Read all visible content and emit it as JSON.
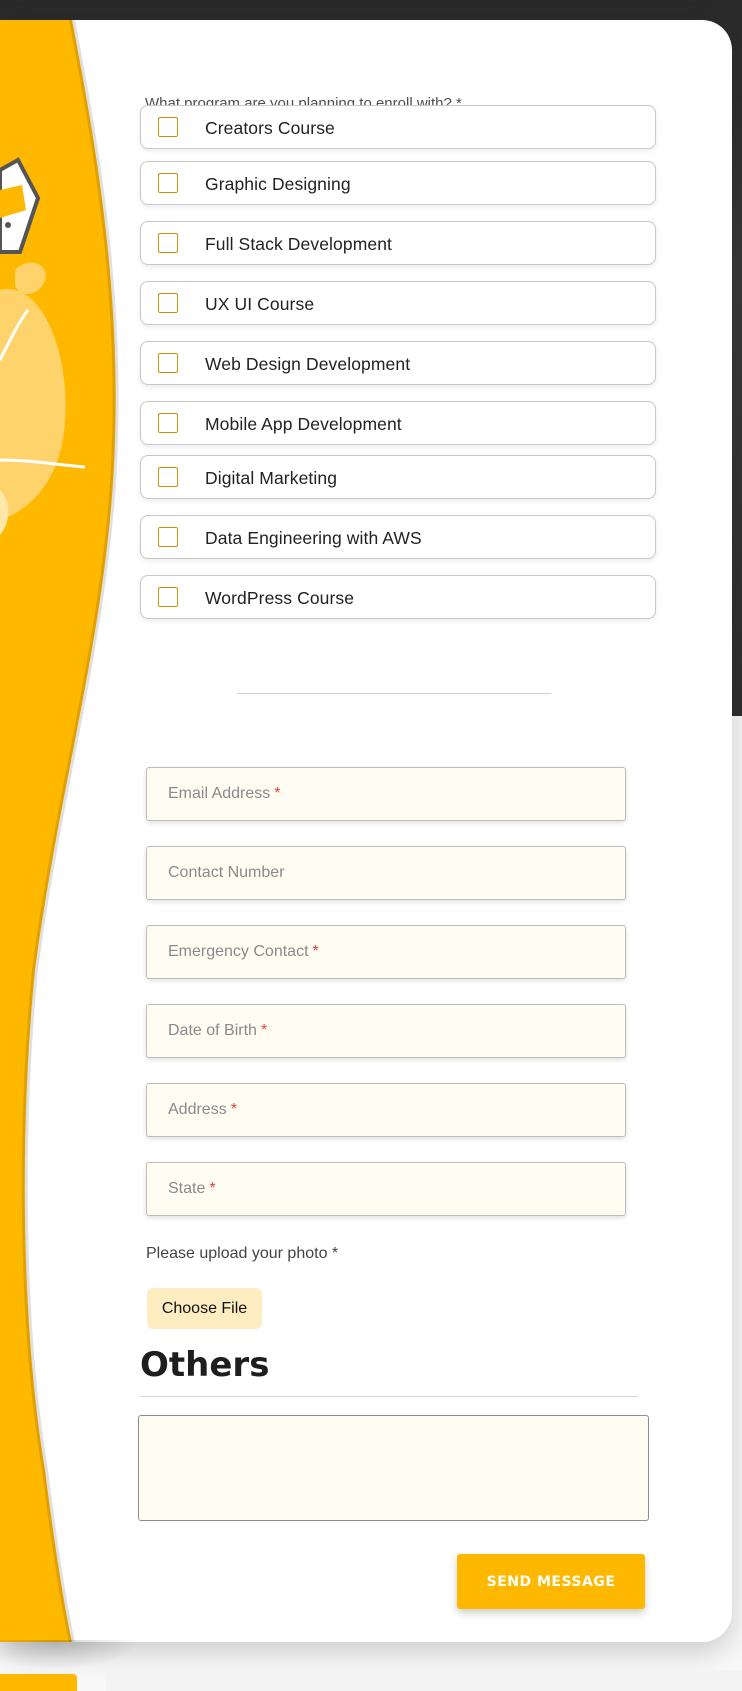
{
  "form": {
    "program_question": "What program are you planning to enroll with? *",
    "programs": [
      {
        "label": "Creators Course"
      },
      {
        "label": "Graphic Designing"
      },
      {
        "label": "Full Stack Development"
      },
      {
        "label": "UX UI Course"
      },
      {
        "label": "Web Design Development"
      },
      {
        "label": "Mobile App Development"
      },
      {
        "label": "Digital Marketing"
      },
      {
        "label": "Data Engineering with AWS"
      },
      {
        "label": "WordPress Course"
      }
    ],
    "fields": [
      {
        "placeholder": "Email Address",
        "required_mark": "*"
      },
      {
        "placeholder": "Contact Number",
        "required_mark": ""
      },
      {
        "placeholder": "Emergency Contact",
        "required_mark": "*"
      },
      {
        "placeholder": "Date of Birth",
        "required_mark": "*"
      },
      {
        "placeholder": "Address",
        "required_mark": "*"
      },
      {
        "placeholder": "State",
        "required_mark": "*"
      }
    ],
    "upload_label": "Please upload your photo *",
    "choose_file_label": "Choose File",
    "others_heading": "Others",
    "send_label": "SEND MESSAGE"
  },
  "colors": {
    "accent": "#ffb800",
    "checkbox_border": "#c9920c",
    "input_bg": "#fffcf2",
    "required": "#e0443c"
  },
  "icons": [
    "decorative-illustration"
  ]
}
